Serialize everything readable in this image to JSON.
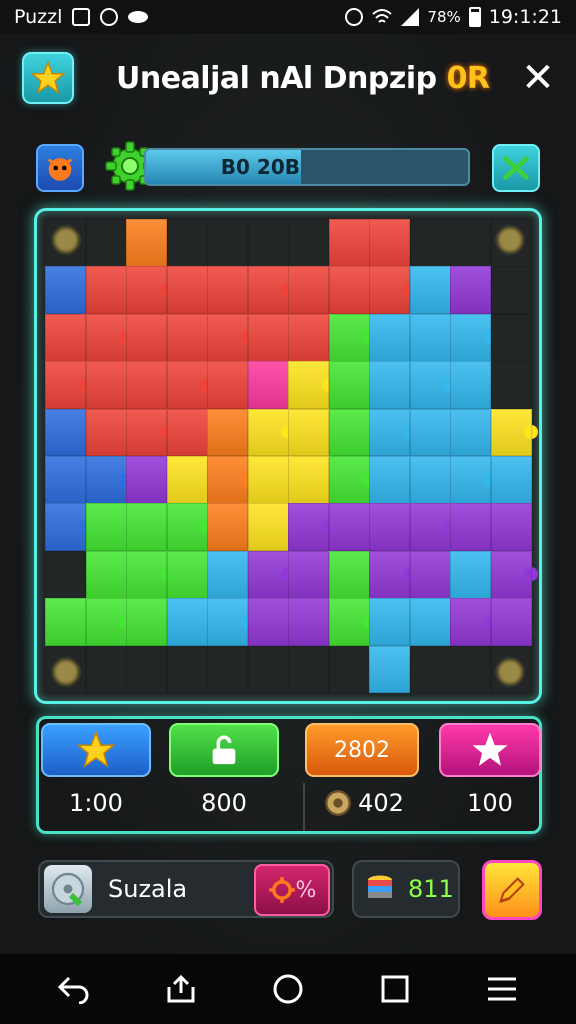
{
  "status_bar": {
    "app_label": "Puzzl",
    "time": "19:1:21",
    "battery": "78%"
  },
  "header": {
    "title": "Unealjal nAl Dnpzip",
    "title_accent": "0R"
  },
  "progress": {
    "label": "B0 20B",
    "fraction": 0.48
  },
  "stats": {
    "top": [
      "",
      "",
      "2802",
      ""
    ],
    "values": [
      "1:00",
      "800",
      "402",
      "100"
    ]
  },
  "bottom": {
    "name": "Suzala",
    "percent": "%",
    "stack_value": "811"
  },
  "colors": {
    "board_glow": "#57f0e2",
    "accent": "#ffc21a"
  },
  "icons": [
    "star-icon",
    "gear-icon",
    "check-icon",
    "unlock-icon",
    "disc-icon",
    "stack-icon",
    "pencil-icon"
  ]
}
